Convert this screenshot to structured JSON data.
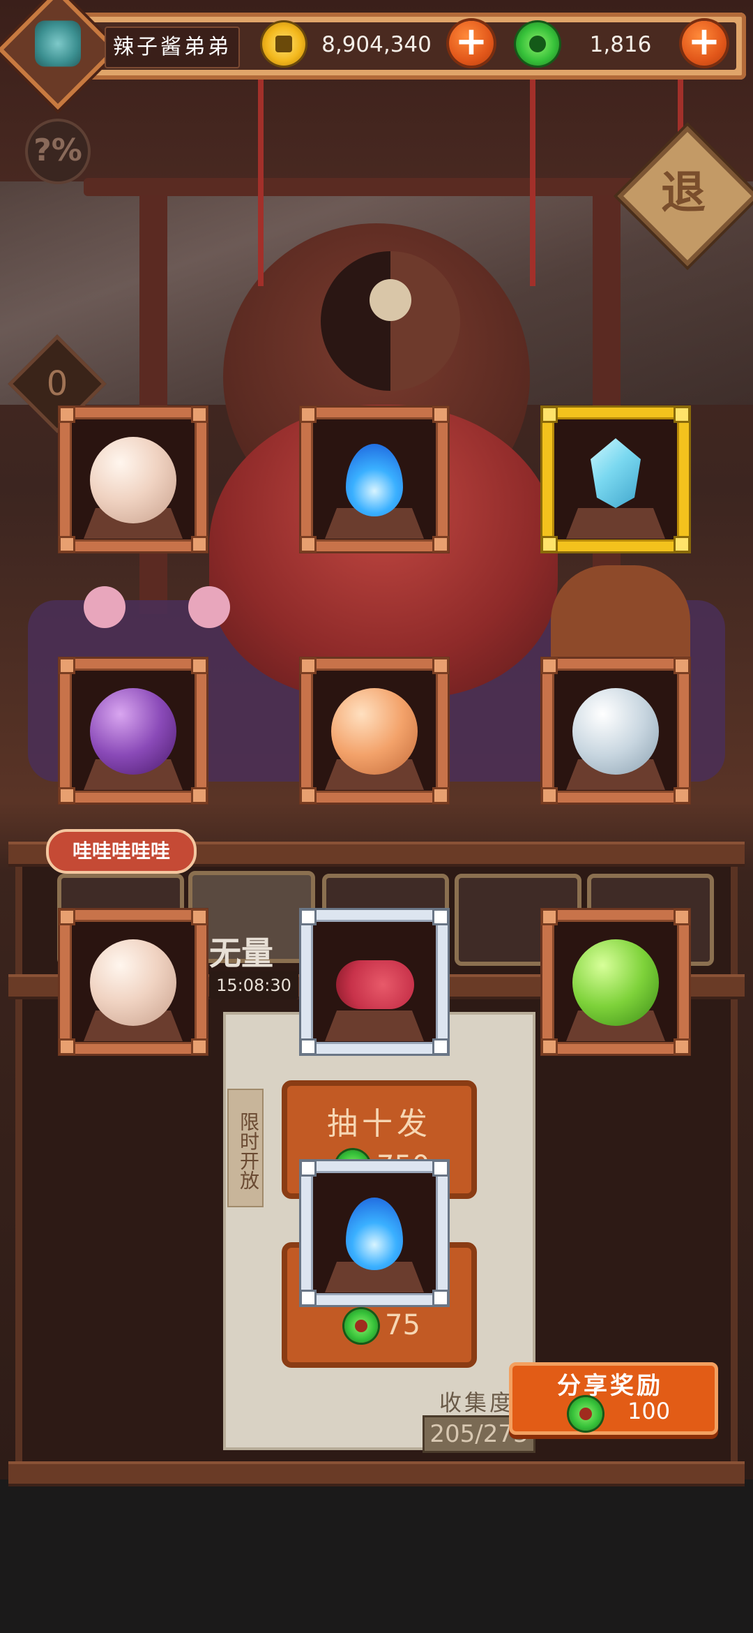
{
  "player": {
    "name": "辣子酱弟弟"
  },
  "currency": {
    "gold": {
      "amount": "8,904,340",
      "icon": "gold-coin-icon"
    },
    "jade": {
      "amount": "1,816",
      "icon": "jade-coin-icon"
    }
  },
  "hud": {
    "rate_icon": "?%",
    "counter": "0",
    "exit_label": "退"
  },
  "cards": [
    {
      "name": "card-cream-orb-scroll",
      "frame": "bronze",
      "icon": "scroll-orb-icon"
    },
    {
      "name": "card-blue-flame",
      "frame": "bronze",
      "icon": "blue-flame-icon"
    },
    {
      "name": "card-crystal",
      "frame": "gold",
      "icon": "crystal-icon"
    },
    {
      "name": "card-purple-mask-orb",
      "frame": "bronze",
      "icon": "mask-orb-icon"
    },
    {
      "name": "card-peach-gem-orb",
      "frame": "bronze",
      "icon": "gem-orb-icon"
    },
    {
      "name": "card-sword-orb",
      "frame": "bronze",
      "icon": "sword-orb-icon"
    },
    {
      "name": "card-cream-orb-scroll-2",
      "frame": "bronze",
      "icon": "scroll-orb-icon"
    },
    {
      "name": "card-meat",
      "frame": "silver",
      "icon": "meat-icon"
    },
    {
      "name": "card-green-jade-orb",
      "frame": "bronze",
      "icon": "jade-orb-icon"
    },
    {
      "name": "card-blue-flame-2",
      "frame": "silver",
      "icon": "blue-flame-icon"
    }
  ],
  "chat_bubble": "哇哇哇哇哇",
  "banner": {
    "title": "无量",
    "timer": "15:08:30",
    "tag": "限时开放"
  },
  "draw": {
    "ten_label": "抽十发",
    "ten_cost": "750",
    "single_cost": "75"
  },
  "collection": {
    "label": "收集度",
    "count": "205/273"
  },
  "share": {
    "label": "分享奖励",
    "reward": "100"
  }
}
